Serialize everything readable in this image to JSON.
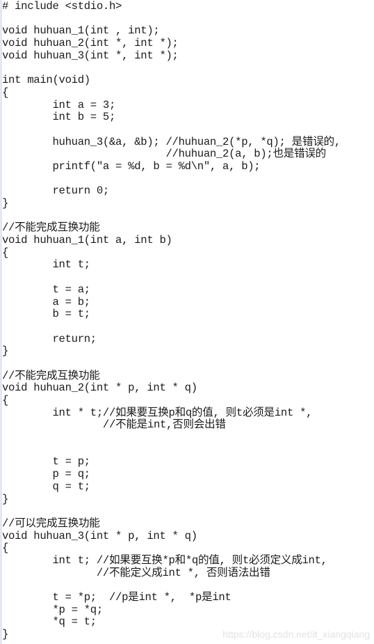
{
  "code_lines": [
    "# include <stdio.h>",
    "",
    "void huhuan_1(int , int);",
    "void huhuan_2(int *, int *);",
    "void huhuan_3(int *, int *);",
    "",
    "int main(void)",
    "{",
    "        int a = 3;",
    "        int b = 5;",
    "",
    "        huhuan_3(&a, &b); //huhuan_2(*p, *q); 是错误的,",
    "                          //huhuan_2(a, b);也是错误的",
    "        printf(\"a = %d, b = %d\\n\", a, b);",
    "",
    "        return 0;",
    "}",
    "",
    "//不能完成互换功能",
    "void huhuan_1(int a, int b)",
    "{",
    "        int t;",
    "",
    "        t = a;",
    "        a = b;",
    "        b = t;",
    "",
    "        return;",
    "}",
    "",
    "//不能完成互换功能",
    "void huhuan_2(int * p, int * q)",
    "{",
    "        int * t;//如果要互换p和q的值, 则t必须是int *,",
    "                //不能是int,否则会出错",
    "",
    "",
    "        t = p;",
    "        p = q;",
    "        q = t;",
    "}",
    "",
    "//可以完成互换功能",
    "void huhuan_3(int * p, int * q)",
    "{",
    "        int t; //如果要互换*p和*q的值, 则t必须定义成int,",
    "               //不能定义成int *, 否则语法出错",
    "",
    "        t = *p;  //p是int *,  *p是int",
    "        *p = *q;",
    "        *q = t;",
    "}"
  ],
  "watermark": "https://blog.csdn.net/it_xiangqiang"
}
